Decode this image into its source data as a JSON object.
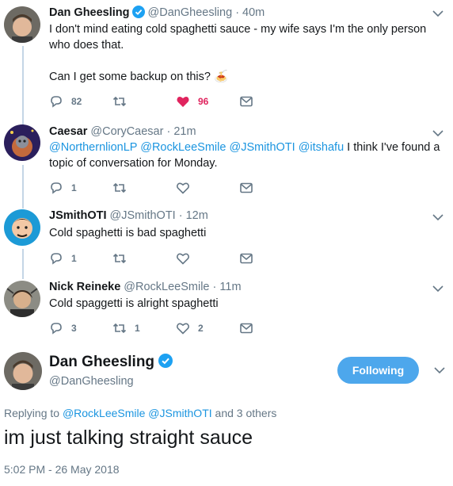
{
  "tweets": [
    {
      "name": "Dan Gheesling",
      "verified": true,
      "handle": "@DanGheesling",
      "time": "· 40m",
      "line1": "I don't mind eating cold spaghetti sauce - my wife says I'm the only person who does that.",
      "line2": "Can I get some backup on this? 🍝",
      "reply_count": "82",
      "retweet_count": "",
      "like_count": "96",
      "liked": true
    },
    {
      "name": "Caesar",
      "handle": "@CoryCaesar",
      "time": "· 21m",
      "mentions": [
        "@NorthernlionLP",
        "@RockLeeSmile",
        "@JSmithOTI",
        "@itshafu"
      ],
      "text_after": " I think I've found a topic of conversation for Monday.",
      "reply_count": "1",
      "retweet_count": "",
      "like_count": ""
    },
    {
      "name": "JSmithOTI",
      "handle": "@JSmithOTI",
      "time": "· 12m",
      "text": "Cold spaghetti is bad spaghetti",
      "reply_count": "1",
      "retweet_count": "",
      "like_count": ""
    },
    {
      "name": "Nick Reineke",
      "handle": "@RockLeeSmile",
      "time": "· 11m",
      "text": "Cold spaggetti is alright spaghetti",
      "reply_count": "3",
      "retweet_count": "1",
      "like_count": "2"
    }
  ],
  "main": {
    "name": "Dan Gheesling",
    "handle": "@DanGheesling",
    "follow_label": "Following",
    "replying_prefix": "Replying to ",
    "replying_mentions": "@RockLeeSmile @JSmithOTI",
    "replying_suffix": " and 3 others",
    "text": "im just talking straight sauce",
    "timestamp": "5:02 PM - 26 May 2018"
  },
  "colors": {
    "accent": "#1b95e0",
    "like": "#e0245e",
    "muted": "#657786",
    "thread_line": "#c4d6e6",
    "follow_button": "#4da7ec"
  },
  "icons": [
    "reply-icon",
    "retweet-icon",
    "like-icon",
    "dm-icon",
    "verified-icon",
    "chevron-down-icon"
  ]
}
